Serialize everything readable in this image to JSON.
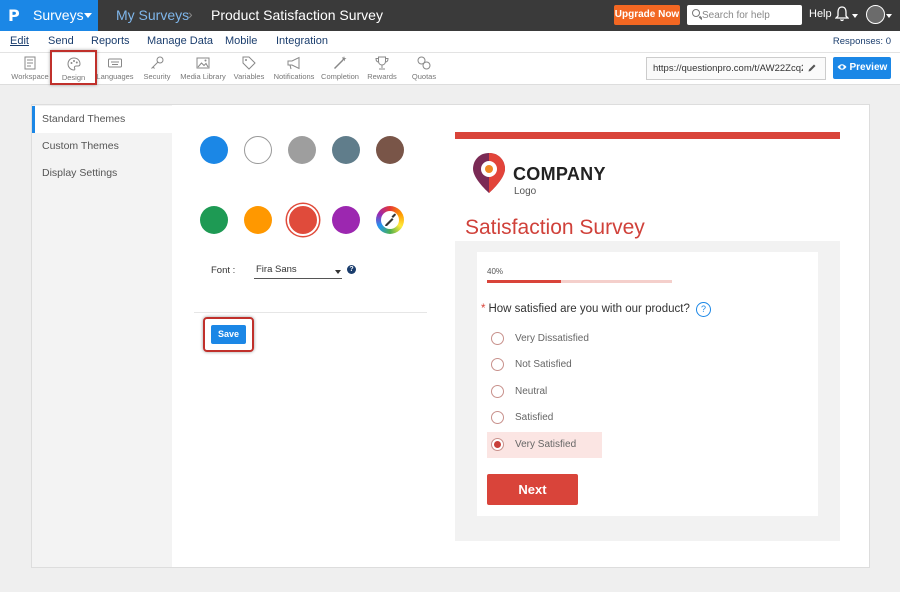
{
  "topbar": {
    "brand_logo": "P",
    "brand_label": "Surveys",
    "breadcrumb_parent": "My Surveys",
    "breadcrumb_sep": "›",
    "survey_title": "Product Satisfaction Survey",
    "upgrade_label": "Upgrade Now",
    "search_placeholder": "Search for help",
    "help_label": "Help"
  },
  "menubar": {
    "items": [
      "Edit",
      "Send",
      "Reports",
      "Manage Data",
      "Mobile",
      "Integration"
    ],
    "responses": "Responses: 0"
  },
  "toolbar": {
    "tools": [
      {
        "label": "Workspace",
        "icon": "workspace-icon"
      },
      {
        "label": "Design",
        "icon": "palette-icon"
      },
      {
        "label": "Languages",
        "icon": "keyboard-icon"
      },
      {
        "label": "Security",
        "icon": "key-icon"
      },
      {
        "label": "Media Library",
        "icon": "image-icon"
      },
      {
        "label": "Variables",
        "icon": "tag-icon"
      },
      {
        "label": "Notifications",
        "icon": "megaphone-icon"
      },
      {
        "label": "Completion",
        "icon": "magic-wand-icon"
      },
      {
        "label": "Rewards",
        "icon": "trophy-icon"
      },
      {
        "label": "Quotas",
        "icon": "quota-icon"
      }
    ],
    "url": "https://questionpro.com/t/AW22Zcq2j",
    "preview_label": "Preview"
  },
  "sidenav": {
    "items": [
      "Standard Themes",
      "Custom Themes",
      "Display Settings"
    ]
  },
  "theme": {
    "swatches": [
      "#1b87e6",
      "#ffffff",
      "#9e9e9e",
      "#607d8b",
      "#795548",
      "#1e9a54",
      "#ff9800",
      "#e04b3b",
      "#9c27b0"
    ],
    "font_label": "Font :",
    "font_value": "Fira Sans",
    "save_label": "Save"
  },
  "preview": {
    "company": "COMPANY",
    "company_sub": "Logo",
    "title": "Satisfaction Survey",
    "progress_label": "40%",
    "progress": 0.4,
    "question_star": "*",
    "question": "How satisfied are you with our product?",
    "question_help": "?",
    "options": [
      "Very Dissatisfied",
      "Not Satisfied",
      "Neutral",
      "Satisfied",
      "Very Satisfied"
    ],
    "selected_option": 4,
    "next_label": "Next"
  }
}
